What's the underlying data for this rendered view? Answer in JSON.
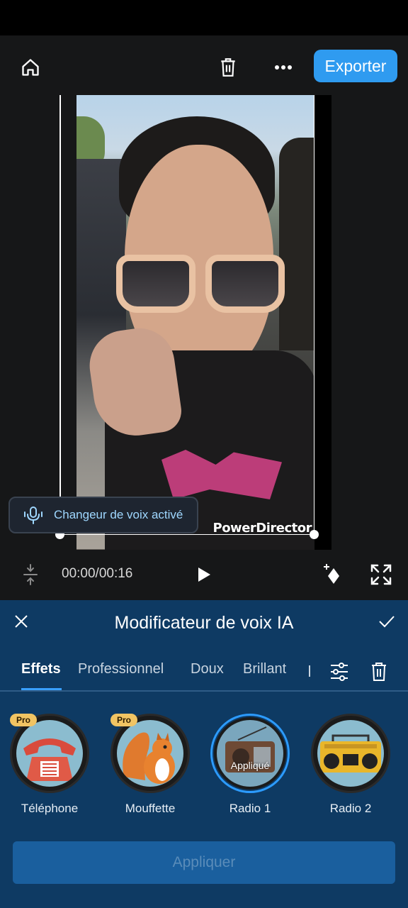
{
  "toolbar": {
    "export_label": "Exporter",
    "home_icon": "home-icon",
    "trash_icon": "trash-icon",
    "more_icon": "more-horizontal-icon"
  },
  "preview": {
    "watermark": "PowerDirector",
    "voice_toast": "Changeur de voix activé"
  },
  "playback": {
    "timecode": "00:00/00:16"
  },
  "panel": {
    "title": "Modificateur de voix IA",
    "tabs": [
      {
        "label": "Effets",
        "active": true
      },
      {
        "label": "Professionnel",
        "active": false
      },
      {
        "label": "Doux",
        "active": false
      },
      {
        "label": "Brillant",
        "active": false
      }
    ],
    "effects": [
      {
        "label": "Téléphone",
        "pro": "Pro",
        "icon": "telephone-icon"
      },
      {
        "label": "Mouffette",
        "pro": "Pro",
        "icon": "squirrel-icon"
      },
      {
        "label": "Radio 1",
        "applied": "Appliqué",
        "icon": "radio-icon"
      },
      {
        "label": "Radio 2",
        "icon": "boombox-icon"
      }
    ],
    "apply_label": "Appliquer"
  },
  "colors": {
    "accent": "#2f9bf0",
    "panel_bg": "#0e3a63",
    "pro_badge": "#f1c463",
    "editor_bg": "#161718"
  }
}
